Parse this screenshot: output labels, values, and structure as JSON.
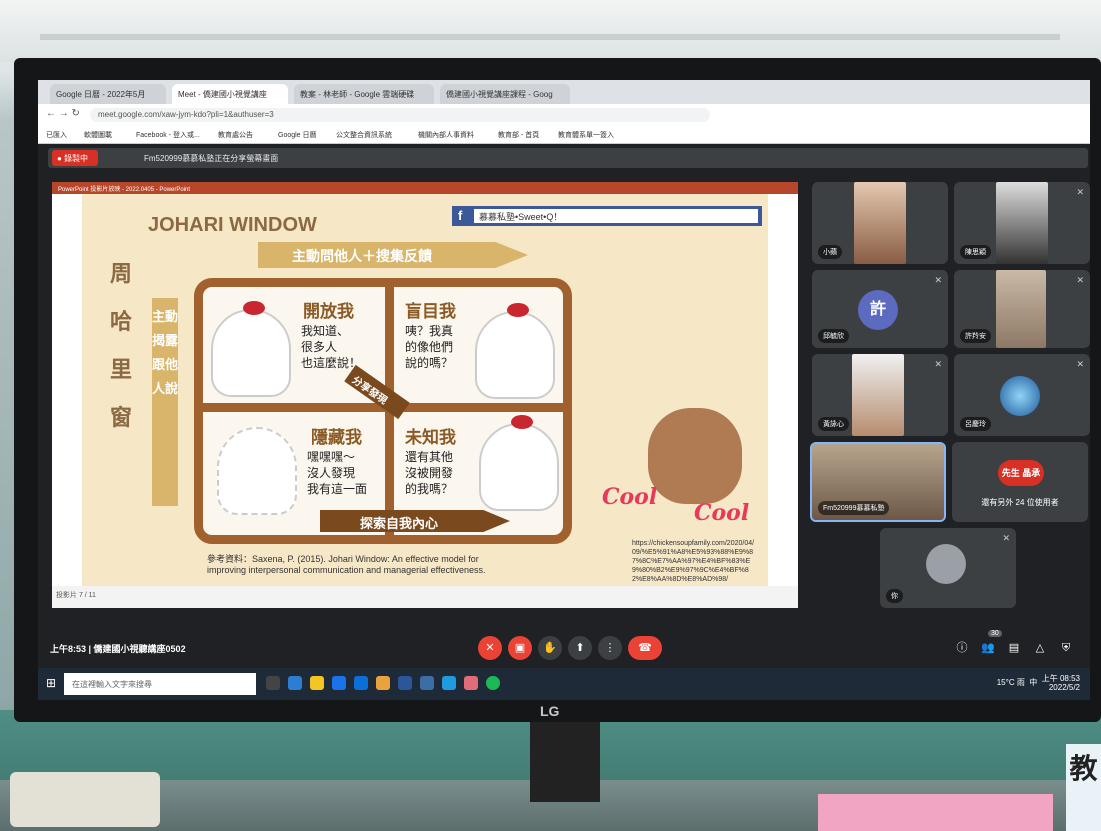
{
  "browser": {
    "tabs": [
      {
        "label": "Google 日曆 - 2022年5月"
      },
      {
        "label": "Meet - 僑建國小視覺講座"
      },
      {
        "label": "教案 - 林老師 - Google 雲端硬碟"
      },
      {
        "label": "僑建國小視覺講座課程 - Goog"
      }
    ],
    "url": "meet.google.com/xaw-jym-kdo?pli=1&authuser=3",
    "bookmarks": [
      "已匯入",
      "軟體圖載",
      "Facebook - 登入或...",
      "教育處公告",
      "Google 日曆",
      "公文整合資訊系統",
      "機關內部人事資料",
      "教育部 - 首頁",
      "教育體系單一簽入"
    ]
  },
  "meet": {
    "recording_label": "錄製中",
    "presenting_text": "Fm520999慕慕私塾正在分享螢幕畫面",
    "ppt_title": "PowerPoint 投影片放映 - 2022.0405 - PowerPoint",
    "ppt_status": "投影片 7 / 11",
    "participants": [
      {
        "name": "小蘋"
      },
      {
        "name": "陳思穎"
      },
      {
        "name": "邱毓欣",
        "initial": "許"
      },
      {
        "name": "許羚安"
      },
      {
        "name": "黃詠心"
      },
      {
        "name": "呂慶玲"
      },
      {
        "name": "Fm520999慕慕私塾"
      },
      {
        "name": "還有另外 24 位使用者",
        "badge": "先生 晶承"
      },
      {
        "name": "你"
      }
    ],
    "meeting_time": "上午8:53",
    "meeting_name": "僑建國小視聽講座0502",
    "participant_count": "30"
  },
  "slide": {
    "title": "JOHARI WINDOW",
    "left_vertical": "周哈里窗",
    "top_arrow": "主動問他人＋搜集反饋",
    "side_arrow": "主動揭露跟他人說",
    "q1_title": "開放我",
    "q1_text": "我知道、\n很多人\n也這麼說！",
    "q2_title": "盲目我",
    "q2_text": "咦？我真\n的像他們\n說的嗎？",
    "q3_title": "隱藏我",
    "q3_text": "嘿嘿嘿～\n沒人發現\n我有這一面",
    "q4_title": "未知我",
    "q4_text": "還有其他\n沒被開發\n的我嗎？",
    "share_label": "分享發現",
    "bottom_arrow": "探索自我內心",
    "reference_line1": "參考資料：Saxena, P. (2015). Johari Window: An effective model for",
    "reference_line2": "improving interpersonal communication and managerial effectiveness.",
    "fb_search": "慕慕私塾•Sweet•Q！",
    "cool1": "Cool",
    "cool2": "Cool",
    "source_url": "https://chickensoupfamily.com/2020/04/09/%E5%91%A8%E5%93%88%E9%87%8C%E7%AA%97%E4%BF%83%E9%80%B2%E9%97%9C%E4%BF%82%E8%AA%8D%E8%AD%98/"
  },
  "taskbar": {
    "search_placeholder": "在這裡輸入文字來搜尋",
    "weather": "15°C 雨",
    "time": "上午 08:53",
    "date": "2022/5/2",
    "ime": "中"
  },
  "monitor_brand": "LG",
  "room_sign": "教"
}
